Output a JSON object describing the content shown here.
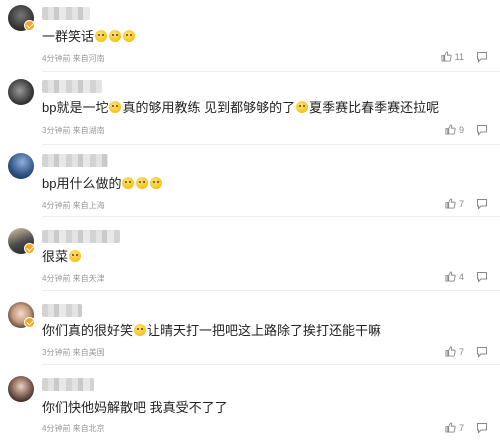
{
  "comments": [
    {
      "text": "一群笑话",
      "emoji_count": 3,
      "meta": "4分钟前 来自河南",
      "likes": "11",
      "badge": true,
      "avatar_color": "#3a3a3a",
      "name_width": 48
    },
    {
      "text_before": "bp就是一坨",
      "text_mid": "真的够用教练 见到都够够的了",
      "text_after": "夏季赛比春季赛还拉呢",
      "meta": "3分钟前 来自湖南",
      "likes": "9",
      "badge": false,
      "avatar_color": "#444",
      "name_width": 60
    },
    {
      "text": "bp用什么做的",
      "emoji_count": 3,
      "meta": "4分钟前 来自上海",
      "likes": "7",
      "badge": false,
      "avatar_color": "#2a4a7a",
      "name_width": 66
    },
    {
      "text": "很菜",
      "emoji_count": 1,
      "meta": "4分钟前 来自天津",
      "likes": "4",
      "badge": true,
      "avatar_color": "#555",
      "name_width": 78
    },
    {
      "text_before": "你们真的很好笑",
      "text_after": "让晴天打一把吧这上路除了挨打还能干嘛",
      "meta": "3分钟前 来自美国",
      "likes": "7",
      "badge": true,
      "avatar_color": "#6b5b4a",
      "name_width": 40
    },
    {
      "text": "你们快他妈解散吧 我真受不了了",
      "meta": "4分钟前 来自北京",
      "likes": "7",
      "badge": false,
      "avatar_color": "#3d3d3d",
      "name_width": 52
    }
  ],
  "icons": {
    "like": "thumbs-up-icon",
    "reply": "comment-icon"
  },
  "colors": {
    "meta": "#999999",
    "badge": "#f6a623",
    "divider": "#eeeeee"
  }
}
